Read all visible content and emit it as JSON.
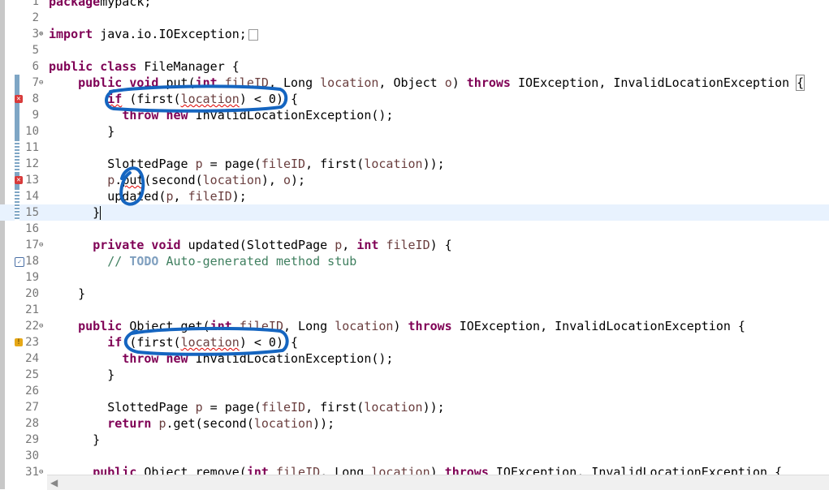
{
  "editor": {
    "language": "java",
    "current_line": 15,
    "lines": [
      {
        "num": "1",
        "tokens": [
          [
            "kw",
            "package"
          ],
          [
            "",
            "mypack;"
          ]
        ]
      },
      {
        "num": "2",
        "tokens": []
      },
      {
        "num": "3",
        "tokens": [
          [
            "kw",
            "import"
          ],
          [
            "",
            " java.io.IOException;"
          ]
        ]
      },
      {
        "num": "5",
        "tokens": []
      },
      {
        "num": "6",
        "tokens": [
          [
            "kw",
            "public class"
          ],
          [
            "",
            " FileManager {"
          ]
        ]
      },
      {
        "num": "7",
        "tokens": [
          [
            "",
            "    "
          ],
          [
            "kw",
            "public void"
          ],
          [
            "",
            " put("
          ],
          [
            "kw",
            "int"
          ],
          [
            "",
            " "
          ],
          [
            "fld",
            "fileID"
          ],
          [
            "",
            ", Long "
          ],
          [
            "fld",
            "location"
          ],
          [
            "",
            ", Object "
          ],
          [
            "fld",
            "o"
          ],
          [
            "",
            ") "
          ],
          [
            "kw",
            "throws"
          ],
          [
            "",
            " IOException, InvalidLocationException "
          ],
          [
            "bracket",
            "{"
          ]
        ]
      },
      {
        "num": "8",
        "tokens": [
          [
            "",
            "        "
          ],
          [
            "kw err",
            "if"
          ],
          [
            "",
            " (first("
          ],
          [
            "fld err",
            "location"
          ],
          [
            "",
            ") < 0) {"
          ]
        ]
      },
      {
        "num": "9",
        "tokens": [
          [
            "",
            "          "
          ],
          [
            "kw",
            "throw new"
          ],
          [
            "",
            " InvalidLocationException();"
          ]
        ]
      },
      {
        "num": "10",
        "tokens": [
          [
            "",
            "        }"
          ]
        ]
      },
      {
        "num": "11",
        "tokens": []
      },
      {
        "num": "12",
        "tokens": [
          [
            "",
            "        SlottedPage "
          ],
          [
            "fld",
            "p"
          ],
          [
            "",
            " = page("
          ],
          [
            "fld",
            "fileID"
          ],
          [
            "",
            ", first("
          ],
          [
            "fld",
            "location"
          ],
          [
            "",
            "));"
          ]
        ]
      },
      {
        "num": "13",
        "tokens": [
          [
            "",
            "        "
          ],
          [
            "fld",
            "p"
          ],
          [
            "",
            "."
          ],
          [
            "err",
            "put"
          ],
          [
            "",
            "(second("
          ],
          [
            "fld",
            "location"
          ],
          [
            "",
            "), "
          ],
          [
            "fld",
            "o"
          ],
          [
            "",
            ");"
          ]
        ]
      },
      {
        "num": "14",
        "tokens": [
          [
            "",
            "        updated("
          ],
          [
            "fld",
            "p"
          ],
          [
            "",
            ", "
          ],
          [
            "fld",
            "fileID"
          ],
          [
            "",
            ");"
          ]
        ]
      },
      {
        "num": "15",
        "tokens": [
          [
            "",
            "      }"
          ],
          [
            "caret",
            ""
          ]
        ]
      },
      {
        "num": "16",
        "tokens": []
      },
      {
        "num": "17",
        "tokens": [
          [
            "",
            "      "
          ],
          [
            "kw",
            "private void"
          ],
          [
            "",
            " updated(SlottedPage "
          ],
          [
            "fld",
            "p"
          ],
          [
            "",
            ", "
          ],
          [
            "kw",
            "int"
          ],
          [
            "",
            " "
          ],
          [
            "fld",
            "fileID"
          ],
          [
            "",
            ") {"
          ]
        ]
      },
      {
        "num": "18",
        "tokens": [
          [
            "",
            "        "
          ],
          [
            "cmt",
            "// "
          ],
          [
            "todo",
            "TODO"
          ],
          [
            "cmt",
            " Auto-generated method stub"
          ]
        ]
      },
      {
        "num": "19",
        "tokens": []
      },
      {
        "num": "20",
        "tokens": [
          [
            "",
            "    }"
          ]
        ]
      },
      {
        "num": "21",
        "tokens": []
      },
      {
        "num": "22",
        "tokens": [
          [
            "",
            "    "
          ],
          [
            "kw",
            "public"
          ],
          [
            "",
            " Object get("
          ],
          [
            "kw",
            "int"
          ],
          [
            "",
            " "
          ],
          [
            "fld",
            "fileID"
          ],
          [
            "",
            ", Long "
          ],
          [
            "fld",
            "location"
          ],
          [
            "",
            ") "
          ],
          [
            "kw",
            "throws"
          ],
          [
            "",
            " IOException, InvalidLocationException {"
          ]
        ]
      },
      {
        "num": "23",
        "tokens": [
          [
            "",
            "        "
          ],
          [
            "kw",
            "if"
          ],
          [
            "",
            " (first("
          ],
          [
            "fld err",
            "location"
          ],
          [
            "",
            ") < 0) {"
          ]
        ]
      },
      {
        "num": "24",
        "tokens": [
          [
            "",
            "          "
          ],
          [
            "kw",
            "throw new"
          ],
          [
            "",
            " InvalidLocationException();"
          ]
        ]
      },
      {
        "num": "25",
        "tokens": [
          [
            "",
            "        }"
          ]
        ]
      },
      {
        "num": "26",
        "tokens": []
      },
      {
        "num": "27",
        "tokens": [
          [
            "",
            "        SlottedPage "
          ],
          [
            "fld",
            "p"
          ],
          [
            "",
            " = page("
          ],
          [
            "fld",
            "fileID"
          ],
          [
            "",
            ", first("
          ],
          [
            "fld",
            "location"
          ],
          [
            "",
            "));"
          ]
        ]
      },
      {
        "num": "28",
        "tokens": [
          [
            "",
            "        "
          ],
          [
            "kw",
            "return"
          ],
          [
            "",
            " "
          ],
          [
            "fld",
            "p"
          ],
          [
            "",
            ".get(second("
          ],
          [
            "fld",
            "location"
          ],
          [
            "",
            "));"
          ]
        ]
      },
      {
        "num": "29",
        "tokens": [
          [
            "",
            "      }"
          ]
        ]
      },
      {
        "num": "30",
        "tokens": []
      },
      {
        "num": "31",
        "tokens": [
          [
            "",
            "      "
          ],
          [
            "kw",
            "public"
          ],
          [
            "",
            " Object remove("
          ],
          [
            "kw",
            "int"
          ],
          [
            "",
            " "
          ],
          [
            "fld",
            "fileID"
          ],
          [
            "",
            ", Long "
          ],
          [
            "fld",
            "location"
          ],
          [
            "",
            ") "
          ],
          [
            "kw",
            "throws"
          ],
          [
            "",
            " IOException, InvalidLocationException {"
          ]
        ]
      }
    ],
    "folded_lines": [
      "3",
      "7",
      "17",
      "22",
      "31"
    ],
    "changed_lines": [
      "7",
      "8",
      "9",
      "10",
      "11",
      "12",
      "13",
      "14",
      "15"
    ],
    "markers": {
      "8": "error",
      "13": "error",
      "18": "task",
      "23": "warn"
    }
  },
  "colors": {
    "annotation": "#1565c0"
  }
}
